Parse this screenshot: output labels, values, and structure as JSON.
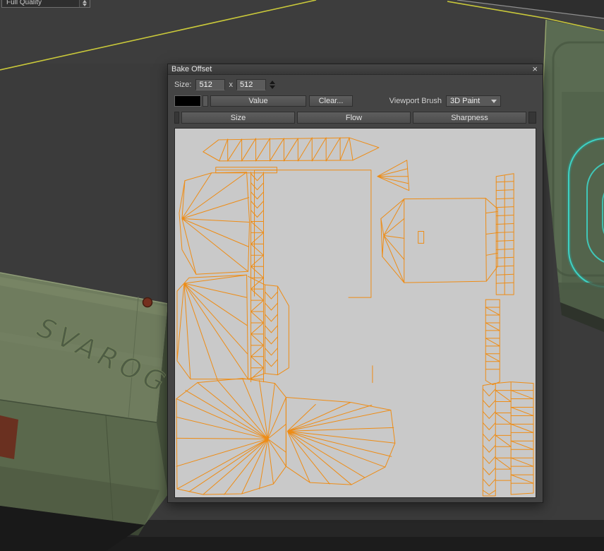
{
  "app": {
    "quality_control": {
      "label": "Full Quality"
    }
  },
  "scene": {
    "crate_label": "SVAROG"
  },
  "dialog": {
    "title": "Bake Offset",
    "close_glyph": "×",
    "size_row": {
      "label": "Size:",
      "width": "512",
      "times": "x",
      "height": "512"
    },
    "paint_row": {
      "value_button": "Value",
      "clear_button": "Clear...",
      "viewport_brush_label": "Viewport Brush",
      "brush_dropdown_value": "3D Paint"
    },
    "channel_tabs": [
      {
        "label": "Size"
      },
      {
        "label": "Flow"
      },
      {
        "label": "Sharpness"
      }
    ],
    "colors": {
      "wireframe_orange": "#ee8c15",
      "canvas_gray": "#c9c9c9",
      "swatch_black": "#000000",
      "guide_yellow": "#c9c83a",
      "ring_teal": "#3ed2c4"
    }
  }
}
